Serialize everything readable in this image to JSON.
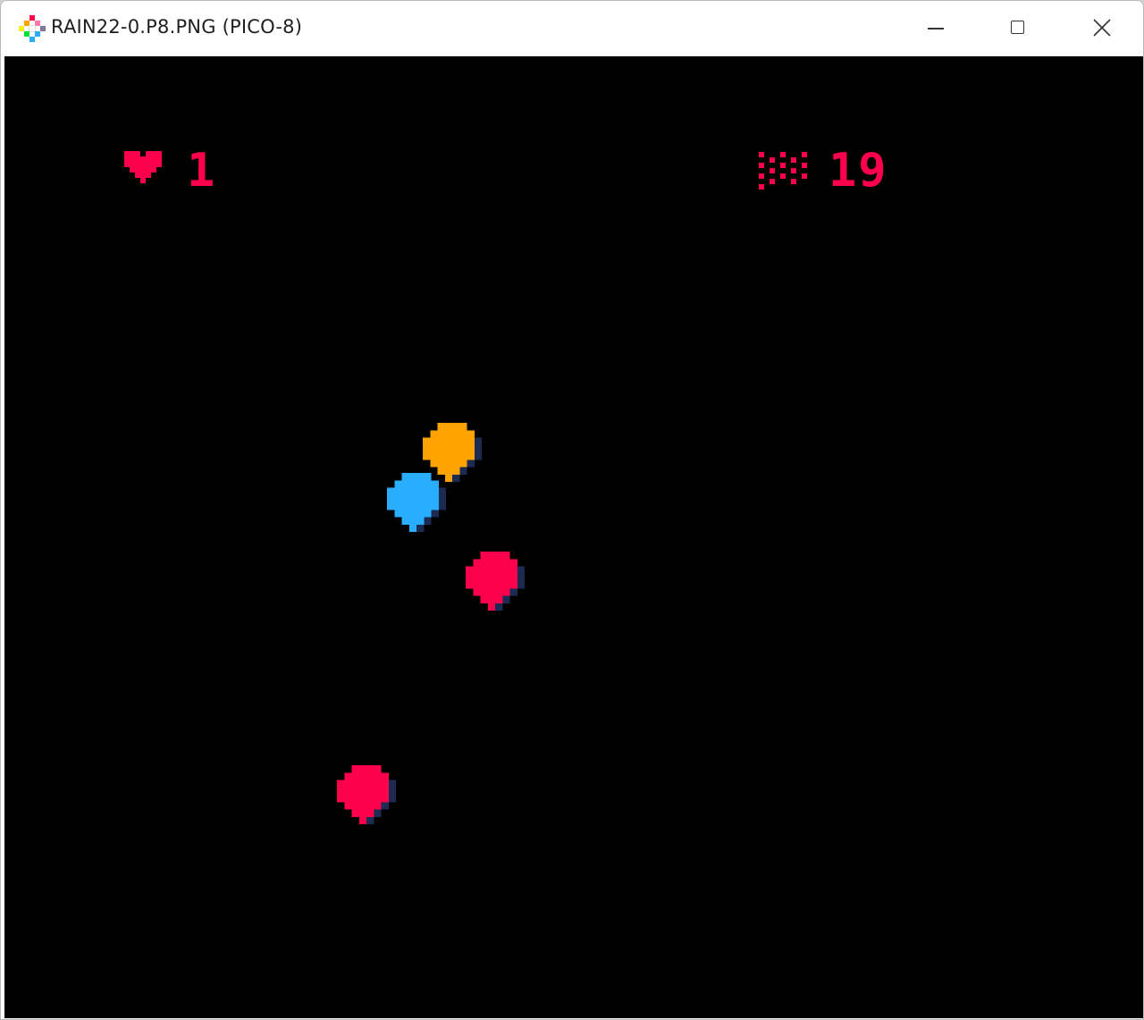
{
  "window": {
    "title": "RAIN22-0.P8.PNG (PICO-8)",
    "icon": "pico8-logo-icon",
    "controls": [
      "minimize-icon",
      "maximize-icon",
      "close-icon"
    ]
  },
  "hud": {
    "lives_icon": "heart-icon",
    "lives": "1",
    "score_icon": "rain-icon",
    "score": "19"
  },
  "colors": {
    "background": "#000000",
    "hud": "#ff004d",
    "drop_orange": "#ffa300",
    "drop_blue": "#29adff",
    "drop_red": "#ff004d",
    "drop_shadow": "#1d2b53"
  },
  "drops": [
    {
      "color": "orange"
    },
    {
      "color": "blue"
    },
    {
      "color": "red"
    },
    {
      "color": "red"
    }
  ]
}
